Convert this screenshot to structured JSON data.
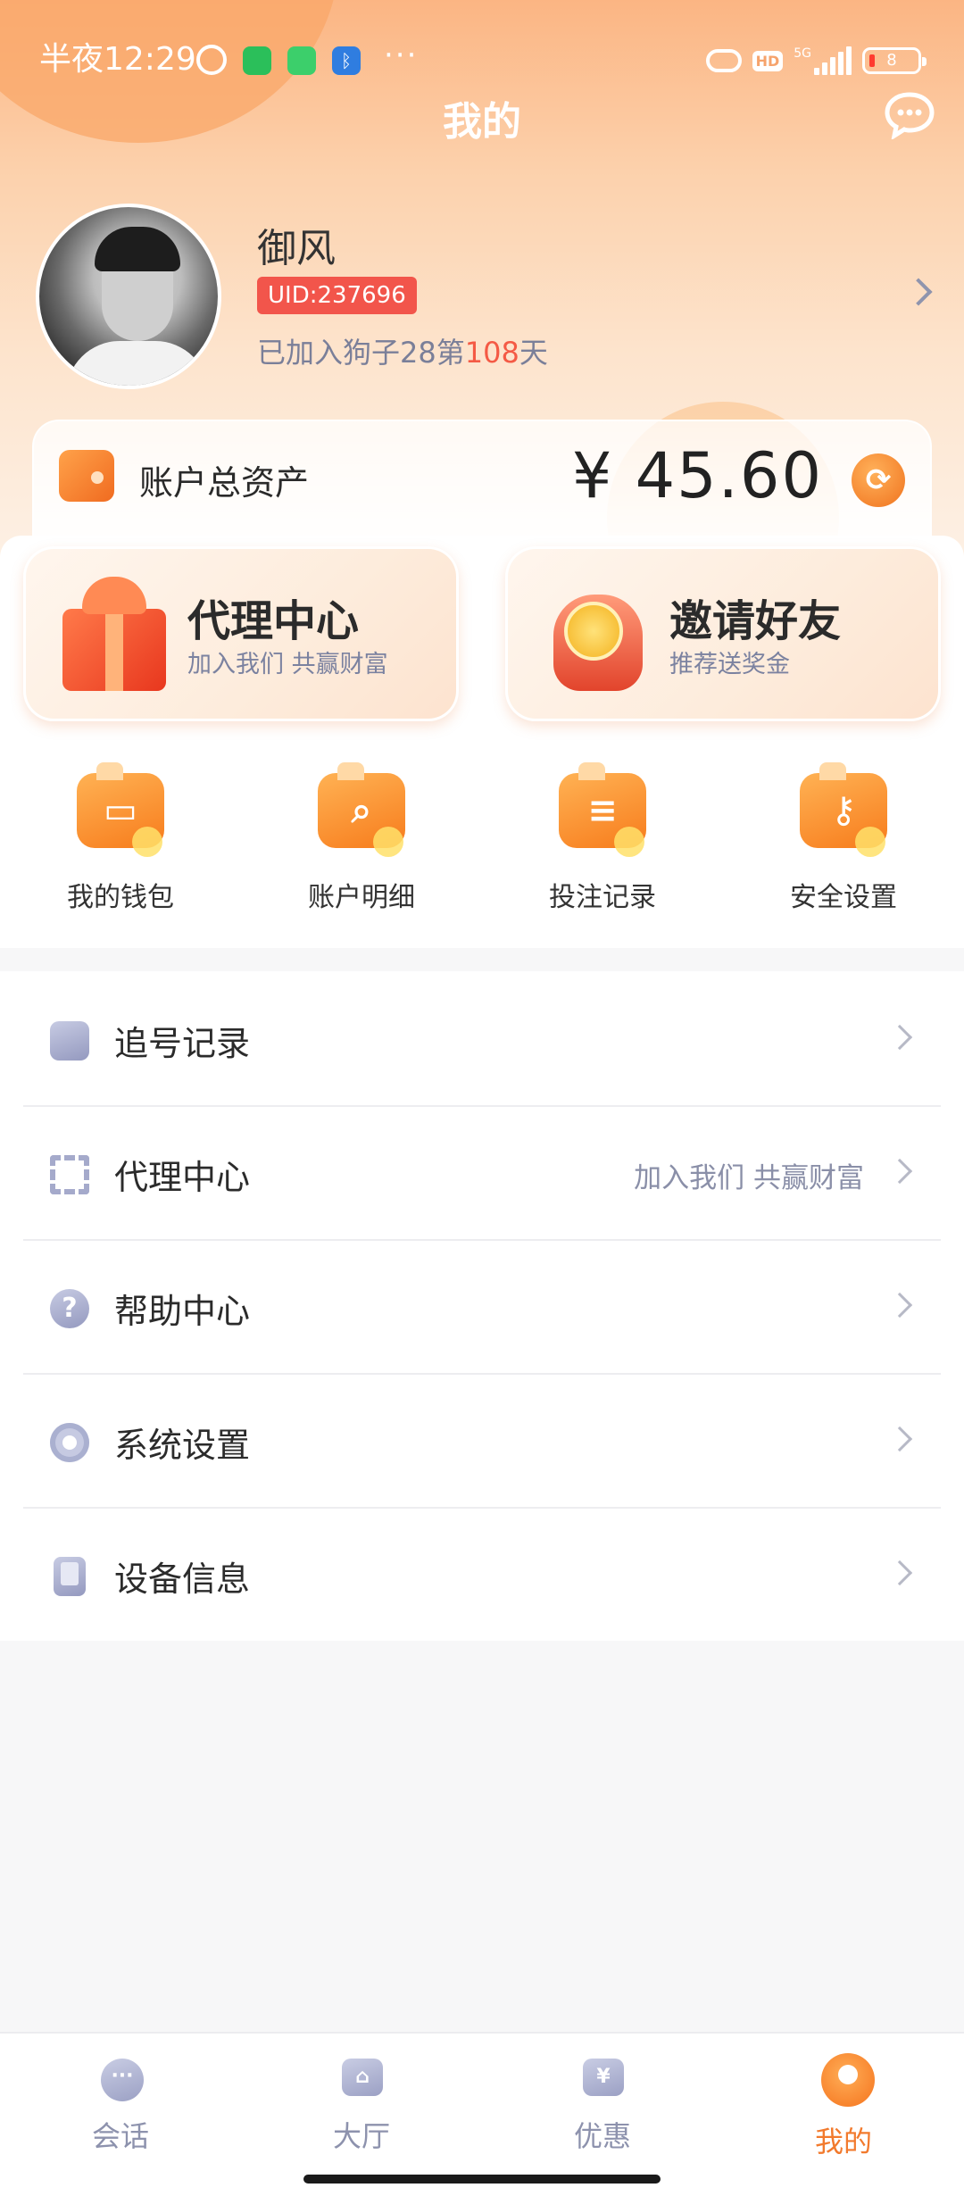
{
  "status_bar": {
    "time": "半夜12:29",
    "more": "···",
    "network": "5G",
    "hd": "HD",
    "battery": "8"
  },
  "header": {
    "title": "我的"
  },
  "profile": {
    "name": "御风",
    "uid": "UID:237696",
    "joined_prefix": "已加入狗子28第",
    "joined_days": "108",
    "joined_suffix": "天"
  },
  "assets": {
    "label": "账户总资产",
    "amount": "¥ 45.60"
  },
  "promos": [
    {
      "title": "代理中心",
      "subtitle": "加入我们 共赢财富"
    },
    {
      "title": "邀请好友",
      "subtitle": "推荐送奖金"
    }
  ],
  "quick_actions": [
    {
      "label": "我的钱包",
      "glyph": "▭"
    },
    {
      "label": "账户明细",
      "glyph": "⌕"
    },
    {
      "label": "投注记录",
      "glyph": "≡"
    },
    {
      "label": "安全设置",
      "glyph": "⚷"
    }
  ],
  "menu": [
    {
      "label": "追号记录",
      "sub": ""
    },
    {
      "label": "代理中心",
      "sub": "加入我们 共赢财富"
    },
    {
      "label": "帮助中心",
      "sub": "",
      "glyph": "?"
    },
    {
      "label": "系统设置",
      "sub": ""
    },
    {
      "label": "设备信息",
      "sub": ""
    }
  ],
  "bottom_nav": [
    {
      "label": "会话",
      "glyph": "···",
      "active": false
    },
    {
      "label": "大厅",
      "glyph": "⌂",
      "active": false
    },
    {
      "label": "优惠",
      "glyph": "¥",
      "active": false
    },
    {
      "label": "我的",
      "glyph": "",
      "active": true
    }
  ],
  "colors": {
    "accent_orange": "#f27a2d",
    "uid_red": "#f2554b",
    "muted_text": "#8a8fa8"
  }
}
